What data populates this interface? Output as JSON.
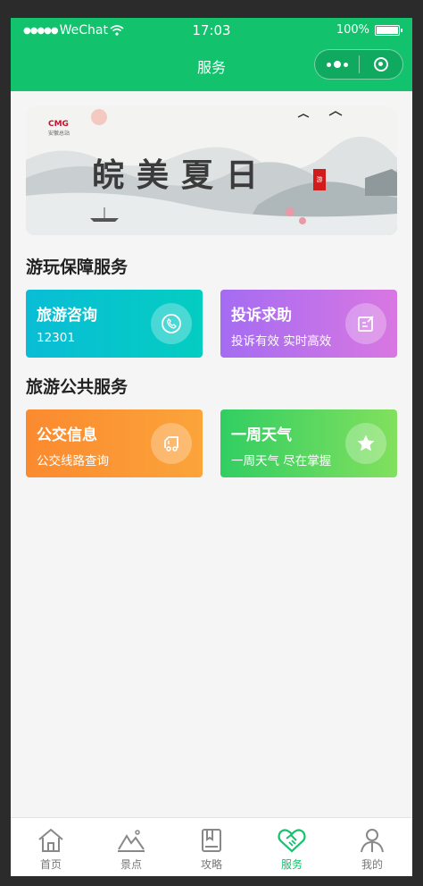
{
  "status_bar": {
    "carrier": "WeChat",
    "time": "17:03",
    "battery": "100%"
  },
  "header": {
    "title": "服务"
  },
  "banner": {
    "slogan": "皖美夏日",
    "logo_text": "CMG",
    "logo_sub": "安徽总站",
    "seal_text": "游"
  },
  "sections": [
    {
      "title": "游玩保障服务"
    },
    {
      "title": "旅游公共服务"
    }
  ],
  "cards": [
    {
      "title": "旅游咨询",
      "subtitle": "12301",
      "icon": "phone-icon"
    },
    {
      "title": "投诉求助",
      "subtitle": "投诉有效 实时高效",
      "icon": "edit-note-icon"
    },
    {
      "title": "公交信息",
      "subtitle": "公交线路查询",
      "icon": "truck-icon"
    },
    {
      "title": "一周天气",
      "subtitle": "一周天气 尽在掌握",
      "icon": "star-icon"
    }
  ],
  "tabs": [
    {
      "label": "首页",
      "icon": "home-icon",
      "active": false
    },
    {
      "label": "景点",
      "icon": "mountain-icon",
      "active": false
    },
    {
      "label": "攻略",
      "icon": "book-icon",
      "active": false
    },
    {
      "label": "服务",
      "icon": "handshake-icon",
      "active": true
    },
    {
      "label": "我的",
      "icon": "user-icon",
      "active": false
    }
  ],
  "colors": {
    "brand": "#12c26d",
    "background": "#f5f5f5"
  }
}
